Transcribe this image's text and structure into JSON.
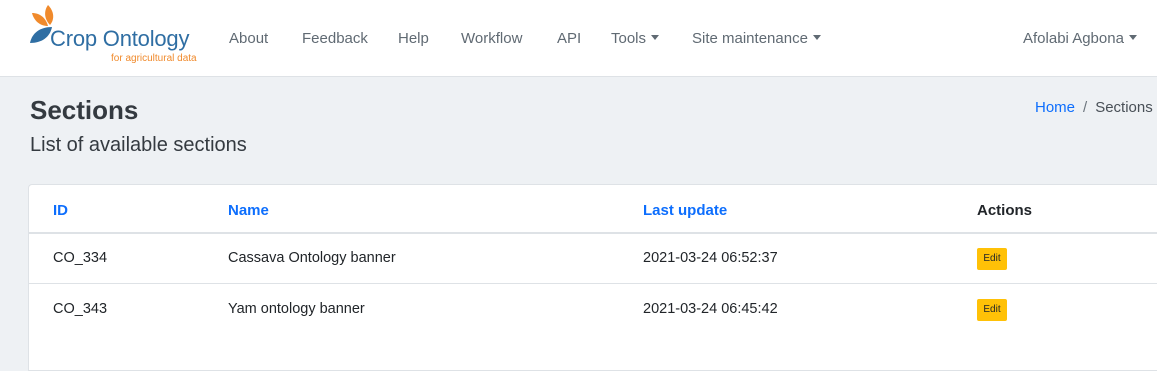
{
  "brand": {
    "title": "Crop Ontology",
    "tagline": "for agricultural data",
    "colors": {
      "leaf_orange": "#f08a2c",
      "leaf_blue": "#2f6ea3"
    }
  },
  "nav": {
    "about": "About",
    "feedback": "Feedback",
    "help": "Help",
    "workflow": "Workflow",
    "api": "API",
    "tools": "Tools",
    "site_maintenance": "Site maintenance",
    "user": "Afolabi Agbona"
  },
  "header": {
    "title": "Sections",
    "subtitle": "List of available sections"
  },
  "breadcrumb": {
    "home": "Home",
    "separator": "/",
    "current": "Sections"
  },
  "table": {
    "columns": {
      "id": "ID",
      "name": "Name",
      "last_update": "Last update",
      "actions": "Actions"
    },
    "rows": [
      {
        "id": "CO_334",
        "name": "Cassava Ontology banner",
        "last_update": "2021-03-24 06:52:37",
        "action": "Edit"
      },
      {
        "id": "CO_343",
        "name": "Yam ontology banner",
        "last_update": "2021-03-24 06:45:42",
        "action": "Edit"
      }
    ]
  },
  "colors": {
    "link": "#0d6efd",
    "edit_button": "#ffc107",
    "page_background": "#eef1f4"
  }
}
